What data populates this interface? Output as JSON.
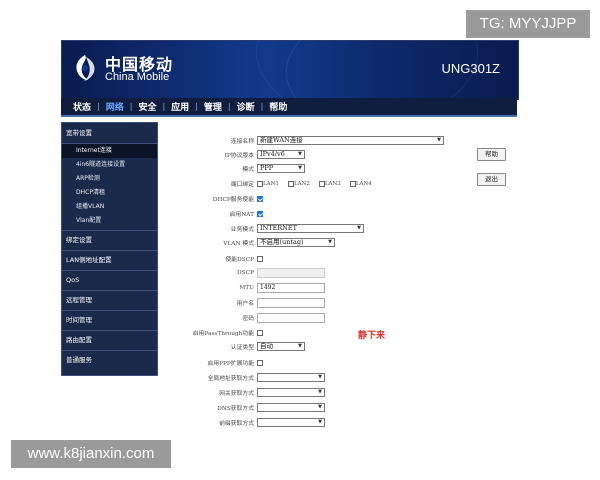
{
  "watermarks": {
    "tg": "TG: MYYJJPP",
    "site": "www.k8jianxin.com"
  },
  "header": {
    "brand_cn": "中国移动",
    "brand_en": "China Mobile",
    "model": "UNG301Z"
  },
  "menu": {
    "items": [
      {
        "label": "状态",
        "active": false
      },
      {
        "label": "网络",
        "active": true
      },
      {
        "label": "安全",
        "active": false
      },
      {
        "label": "应用",
        "active": false
      },
      {
        "label": "管理",
        "active": false
      },
      {
        "label": "诊断",
        "active": false
      },
      {
        "label": "帮助",
        "active": false
      }
    ]
  },
  "sidebar": {
    "group": "宽带设置",
    "subitems": [
      "Internet连接",
      "4in6隧道连接设置",
      "ARP检测",
      "DHCP清租",
      "组播VLAN",
      "Vlan配置"
    ],
    "active_subitem": "Internet连接",
    "items": [
      "绑定设置",
      "LAN侧地址配置",
      "QoS",
      "远程管理",
      "时间管理",
      "路由配置",
      "普通服务"
    ]
  },
  "form": {
    "conn_name": {
      "label": "连接名称",
      "value": "新建WAN连接"
    },
    "ip_version": {
      "label": "IP协议版本",
      "value": "IPv4/v6"
    },
    "mode": {
      "label": "模式",
      "value": "PPP"
    },
    "port_bind": {
      "label": "端口绑定",
      "ports": [
        "LAN1",
        "LAN2",
        "LAN3",
        "LAN4"
      ]
    },
    "dhcp_server": {
      "label": "DHCP服务使能",
      "checked": true
    },
    "nat": {
      "label": "启用NAT",
      "checked": true
    },
    "service_mode": {
      "label": "业务模式",
      "value": "INTERNET"
    },
    "vlan_mode": {
      "label": "VLAN 模式",
      "value": "不启用(untag)"
    },
    "bind_dscp": {
      "label": "使能DSCP",
      "checked": false
    },
    "dscp": {
      "label": "DSCP",
      "value": ""
    },
    "mtu": {
      "label": "MTU",
      "value": "1492"
    },
    "username": {
      "label": "用户名",
      "value": ""
    },
    "password": {
      "label": "密码",
      "value": ""
    },
    "passthrough": {
      "label": "启用PassThrough功能",
      "checked": false
    },
    "auth_type": {
      "label": "认证类型",
      "value": "自动"
    },
    "ppp_ext": {
      "label": "启用PPP扩展功能",
      "checked": false
    },
    "global_addr": {
      "label": "全局地址获取方式",
      "value": ""
    },
    "gateway": {
      "label": "网关获取方式",
      "value": ""
    },
    "dns": {
      "label": "DNS获取方式",
      "value": ""
    },
    "prefix": {
      "label": "前缀获取方式",
      "value": ""
    }
  },
  "buttons": {
    "help": "帮助",
    "logout": "退出"
  },
  "annotation": "静下来"
}
